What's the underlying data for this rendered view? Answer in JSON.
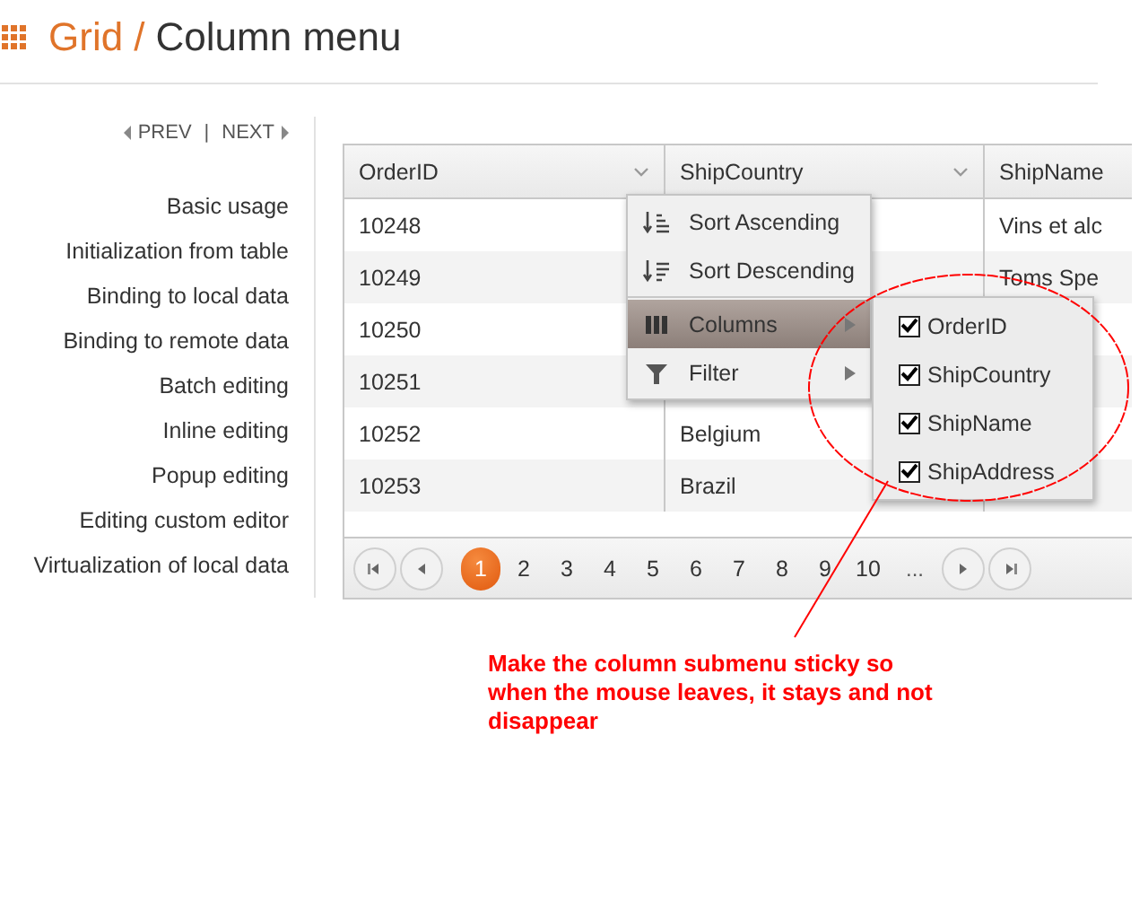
{
  "header": {
    "section": "Grid /",
    "page": "Column menu"
  },
  "nav": {
    "prev": "PREV",
    "separator": "|",
    "next": "NEXT"
  },
  "sidebar": {
    "items": [
      "Basic usage",
      "Initialization from table",
      "Binding to local data",
      "Binding to remote data",
      "Batch editing",
      "Inline editing",
      "Popup editing",
      "Editing custom editor",
      "Virtualization of local data"
    ]
  },
  "grid": {
    "columns": [
      {
        "label": "OrderID"
      },
      {
        "label": "ShipCountry"
      },
      {
        "label": "ShipName"
      }
    ],
    "rows": [
      {
        "cells": [
          "10248",
          null,
          "Vins et alc"
        ]
      },
      {
        "cells": [
          "10249",
          null,
          "Toms Spe"
        ]
      },
      {
        "cells": [
          "10250",
          null,
          null
        ]
      },
      {
        "cells": [
          "10251",
          null,
          null
        ]
      },
      {
        "cells": [
          "10252",
          "Belgium",
          null
        ]
      },
      {
        "cells": [
          "10253",
          "Brazil",
          null
        ]
      }
    ]
  },
  "column_menu": {
    "items": [
      {
        "kind": "sort-asc",
        "label": "Sort Ascending",
        "selected": false,
        "submenu": false
      },
      {
        "kind": "sort-desc",
        "label": "Sort Descending",
        "selected": false,
        "submenu": false
      },
      {
        "kind": "columns",
        "label": "Columns",
        "selected": true,
        "submenu": true
      },
      {
        "kind": "filter",
        "label": "Filter",
        "selected": false,
        "submenu": true
      }
    ]
  },
  "columns_submenu": {
    "items": [
      {
        "label": "OrderID",
        "checked": true
      },
      {
        "label": "ShipCountry",
        "checked": true
      },
      {
        "label": "ShipName",
        "checked": true
      },
      {
        "label": "ShipAddress",
        "checked": true
      }
    ]
  },
  "pager": {
    "pages": [
      {
        "label": "1",
        "selected": true
      },
      {
        "label": "2",
        "selected": false
      },
      {
        "label": "3",
        "selected": false
      },
      {
        "label": "4",
        "selected": false
      },
      {
        "label": "5",
        "selected": false
      },
      {
        "label": "6",
        "selected": false
      },
      {
        "label": "7",
        "selected": false
      },
      {
        "label": "8",
        "selected": false
      },
      {
        "label": "9",
        "selected": false
      },
      {
        "label": "10",
        "selected": false
      }
    ],
    "more": "..."
  },
  "annotation": {
    "text": "Make the column submenu sticky so when the mouse leaves, it stays and not disappear"
  }
}
